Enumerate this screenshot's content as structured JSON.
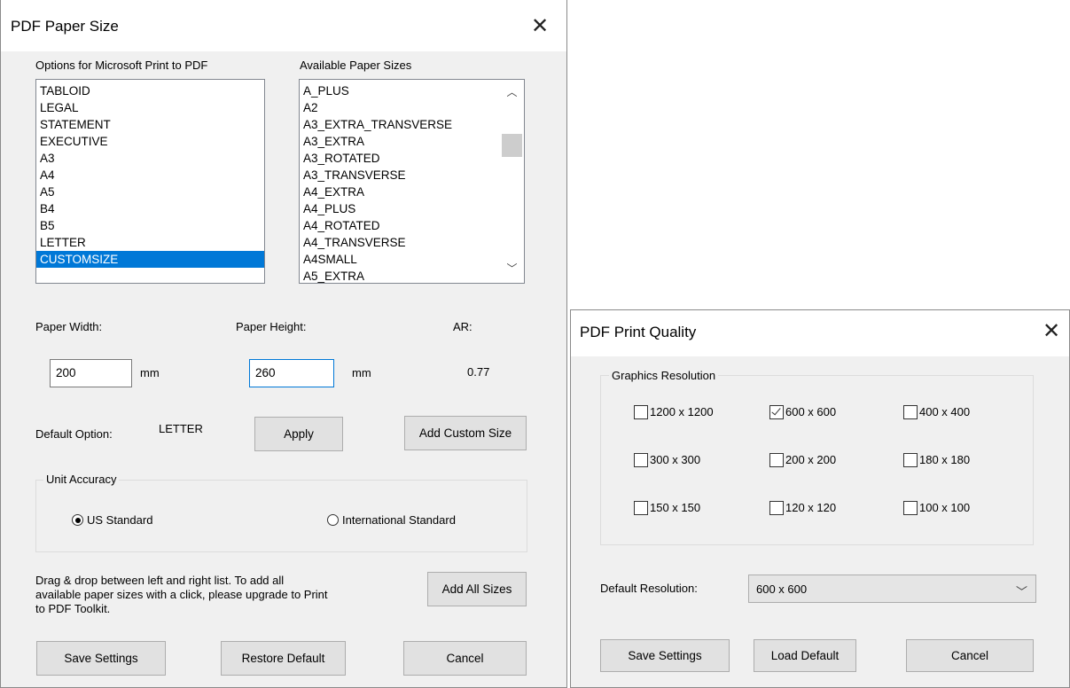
{
  "paper_dialog": {
    "title": "PDF Paper Size",
    "close_glyph": "✕",
    "options_label": "Options for Microsoft Print to PDF",
    "available_label": "Available Paper Sizes",
    "options_items": [
      "TABLOID",
      "LEGAL",
      "STATEMENT",
      "EXECUTIVE",
      "A3",
      "A4",
      "A5",
      "B4",
      "B5",
      "LETTER",
      "CUSTOMSIZE"
    ],
    "selected_option": "CUSTOMSIZE",
    "available_items": [
      "A_PLUS",
      "A2",
      "A3_EXTRA_TRANSVERSE",
      "A3_EXTRA",
      "A3_ROTATED",
      "A3_TRANSVERSE",
      "A4_EXTRA",
      "A4_PLUS",
      "A4_ROTATED",
      "A4_TRANSVERSE",
      "A4SMALL",
      "A5_EXTRA"
    ],
    "scroll_up_glyph": "︿",
    "scroll_down_glyph": "﹀",
    "paper_width_label": "Paper Width:",
    "paper_height_label": "Paper Height:",
    "ar_label": "AR:",
    "width_value": "200",
    "height_value": "260",
    "unit_mm": "mm",
    "ar_value": "0.77",
    "default_option_label": "Default Option:",
    "default_option_value": "LETTER",
    "apply_button": "Apply",
    "add_custom_button": "Add Custom Size",
    "unit_accuracy_title": "Unit Accuracy",
    "us_standard_label": "US Standard",
    "international_label": "International Standard",
    "us_selected": true,
    "help_line1": "Drag & drop between left and right list. To add all",
    "help_line2": "available paper sizes with a click, please upgrade to Print",
    "help_line3": "to PDF Toolkit.",
    "add_all_button": "Add All Sizes",
    "save_button": "Save Settings",
    "restore_button": "Restore Default",
    "cancel_button": "Cancel"
  },
  "quality_dialog": {
    "title": "PDF Print Quality",
    "close_glyph": "✕",
    "graphics_title": "Graphics Resolution",
    "resolutions": [
      {
        "label": "1200 x 1200",
        "checked": false
      },
      {
        "label": "600 x 600",
        "checked": true
      },
      {
        "label": "400 x 400",
        "checked": false
      },
      {
        "label": "300 x 300",
        "checked": false
      },
      {
        "label": "200 x 200",
        "checked": false
      },
      {
        "label": "180 x 180",
        "checked": false
      },
      {
        "label": "150 x 150",
        "checked": false
      },
      {
        "label": "120 x 120",
        "checked": false
      },
      {
        "label": "100 x 100",
        "checked": false
      }
    ],
    "default_resolution_label": "Default Resolution:",
    "default_resolution_value": "600 x 600",
    "dropdown_glyph": "﹀",
    "save_button": "Save Settings",
    "load_default_button": "Load Default",
    "cancel_button": "Cancel"
  }
}
